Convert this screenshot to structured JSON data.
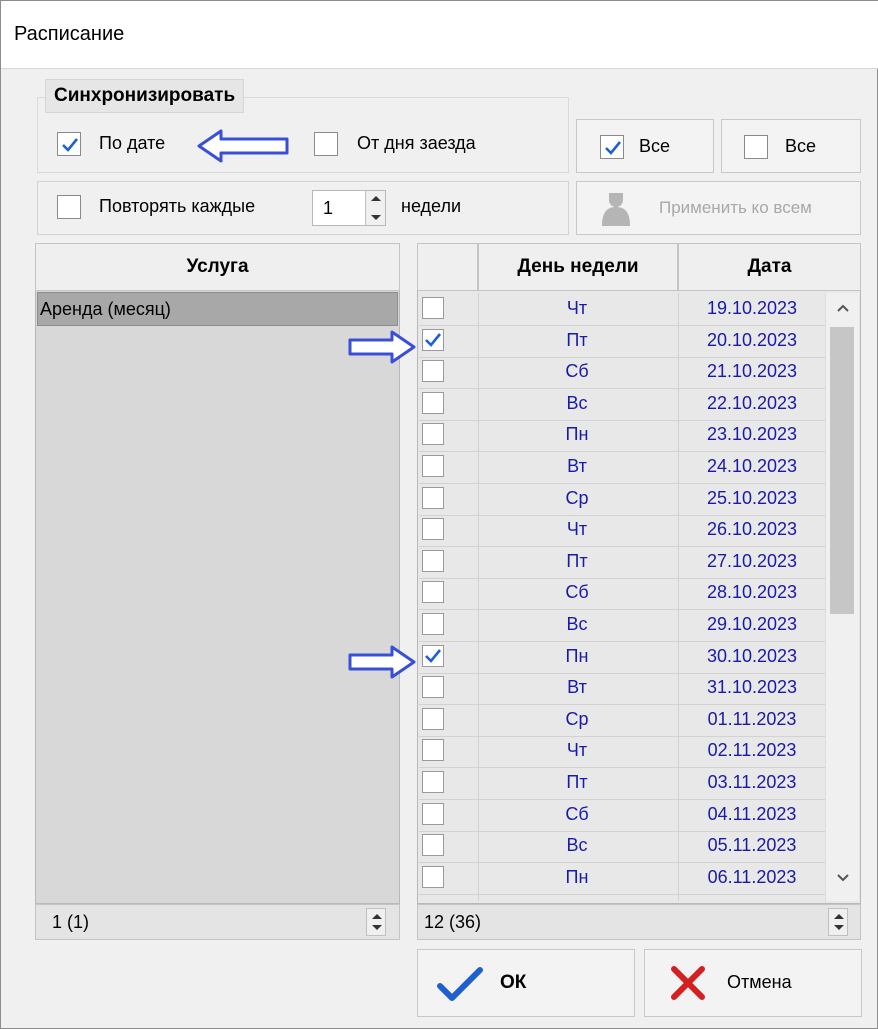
{
  "window": {
    "title": "Расписание"
  },
  "sync": {
    "legend": "Синхронизировать",
    "by_date_label": "По дате",
    "by_date_checked": true,
    "from_checkin_label": "От дня заезда",
    "from_checkin_checked": false
  },
  "select_all": {
    "label": "Все",
    "checked": true
  },
  "deselect_all": {
    "label": "Все",
    "checked": false
  },
  "repeat": {
    "label": "Повторять каждые",
    "value": "1",
    "unit": "недели",
    "checked": false
  },
  "apply_all_label": "Применить ко всем",
  "services": {
    "header": "Услуга",
    "items": [
      {
        "name": "Аренда (месяц)"
      }
    ],
    "counter": "1 (1)"
  },
  "schedule": {
    "header_day": "День недели",
    "header_date": "Дата",
    "rows": [
      {
        "day": "Чт",
        "date": "19.10.2023",
        "checked": false
      },
      {
        "day": "Пт",
        "date": "20.10.2023",
        "checked": true
      },
      {
        "day": "Сб",
        "date": "21.10.2023",
        "checked": false
      },
      {
        "day": "Вс",
        "date": "22.10.2023",
        "checked": false
      },
      {
        "day": "Пн",
        "date": "23.10.2023",
        "checked": false
      },
      {
        "day": "Вт",
        "date": "24.10.2023",
        "checked": false
      },
      {
        "day": "Ср",
        "date": "25.10.2023",
        "checked": false
      },
      {
        "day": "Чт",
        "date": "26.10.2023",
        "checked": false
      },
      {
        "day": "Пт",
        "date": "27.10.2023",
        "checked": false
      },
      {
        "day": "Сб",
        "date": "28.10.2023",
        "checked": false
      },
      {
        "day": "Вс",
        "date": "29.10.2023",
        "checked": false
      },
      {
        "day": "Пн",
        "date": "30.10.2023",
        "checked": true
      },
      {
        "day": "Вт",
        "date": "31.10.2023",
        "checked": false
      },
      {
        "day": "Ср",
        "date": "01.11.2023",
        "checked": false
      },
      {
        "day": "Чт",
        "date": "02.11.2023",
        "checked": false
      },
      {
        "day": "Пт",
        "date": "03.11.2023",
        "checked": false
      },
      {
        "day": "Сб",
        "date": "04.11.2023",
        "checked": false
      },
      {
        "day": "Вс",
        "date": "05.11.2023",
        "checked": false
      },
      {
        "day": "Пн",
        "date": "06.11.2023",
        "checked": false
      }
    ],
    "counter": "12 (36)"
  },
  "buttons": {
    "ok": "ОК",
    "cancel": "Отмена"
  },
  "colors": {
    "check": "#1f5fd1",
    "date_text": "#1a1aa8",
    "annotation_arrow": "#3a4fd8",
    "cancel_x": "#d42020"
  },
  "icons": {
    "ok": "checkmark-icon",
    "cancel": "x-icon",
    "apply_all": "user-silhouette-icon",
    "annotation": "arrow-icon"
  }
}
